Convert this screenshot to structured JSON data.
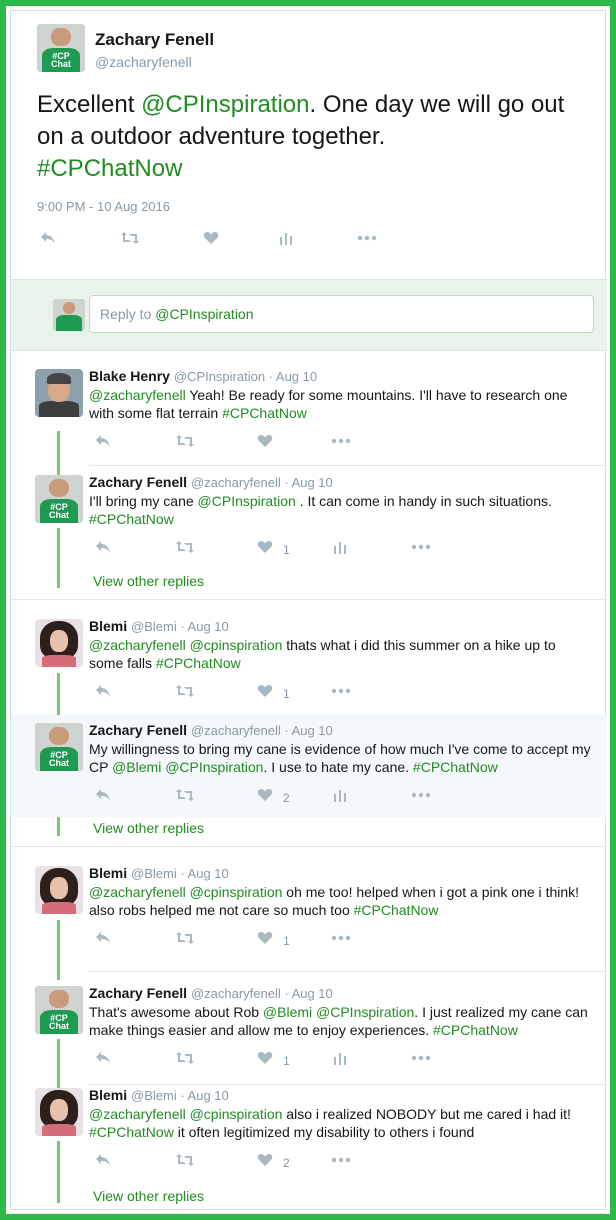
{
  "main_tweet": {
    "name": "Zachary Fenell",
    "handle": "@zacharyfenell",
    "text_before": "Excellent ",
    "mention": "@CPInspiration",
    "text_after": ". One day we will go out on a outdoor adventure together.",
    "hashtag": "#CPChatNow",
    "timestamp": "9:00 PM - 10 Aug 2016"
  },
  "reply_box": {
    "prefix": "Reply to ",
    "mention": "@CPInspiration"
  },
  "replies": [
    {
      "name": "Blake Henry",
      "meta": "@CPInspiration · Aug 10",
      "line1": "@zacharyfenell Yeah! Be ready for some mountains.  I'll have to research one",
      "line2": "with some flat terrain #CPChatNow",
      "likes": ""
    },
    {
      "name": "Zachary Fenell",
      "meta": "@zacharyfenell · Aug 10",
      "line1": "I'll bring my cane @CPInspiration . It can come in handy in such situations.",
      "line2": "#CPChatNow",
      "likes": "1",
      "view_replies": "View other replies"
    },
    {
      "name": "Blemi",
      "meta": "@Blemi · Aug 10",
      "line1": "@zacharyfenell @cpinspiration thats what i did this summer on a hike up to",
      "line2": "some falls #CPChatNow",
      "likes": "1"
    },
    {
      "name": "Zachary Fenell",
      "meta": "@zacharyfenell · Aug 10",
      "line1": "My willingness to bring my cane is evidence of how much I've come to accept my",
      "line2": "CP @Blemi @CPInspiration. I use to hate my cane. #CPChatNow",
      "likes": "2",
      "view_replies": "View other replies"
    },
    {
      "name": "Blemi",
      "meta": "@Blemi · Aug 10",
      "line1": "@zacharyfenell @cpinspiration oh me too! helped when i got a pink one i think!",
      "line2": "also robs helped me not care so much too #CPChatNow",
      "likes": "1"
    },
    {
      "name": "Zachary Fenell",
      "meta": "@zacharyfenell · Aug 10",
      "line1": "That's awesome about Rob @Blemi @CPInspiration. I just realized my cane can",
      "line2": "make things easier and allow me to enjoy experiences. #CPChatNow",
      "likes": "1"
    },
    {
      "name": "Blemi",
      "meta": "@Blemi · Aug 10",
      "line1": "@zacharyfenell @cpinspiration also i realized NOBODY but me cared i had it!",
      "line2": "#CPChatNow it often legitimized my disability to others i found",
      "likes": "2",
      "view_replies": "View other replies"
    }
  ],
  "avatar_shirt_text": "#CP Chat Now",
  "icons": [
    "reply-icon",
    "retweet-icon",
    "like-icon",
    "analytics-icon",
    "more-icon"
  ],
  "colors": {
    "border": "#2db84a",
    "link": "#228b22",
    "muted": "#8899a6",
    "thread": "#7cc576"
  }
}
